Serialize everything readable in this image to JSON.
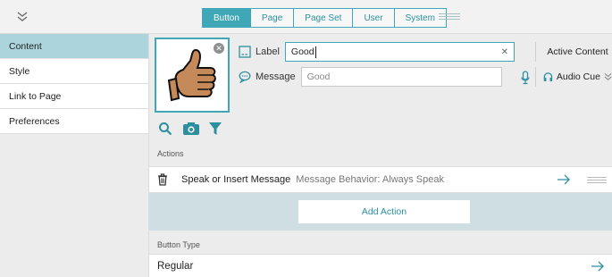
{
  "toolbar": {
    "tabs": [
      {
        "label": "Button",
        "active": true
      },
      {
        "label": "Page",
        "active": false
      },
      {
        "label": "Page Set",
        "active": false
      },
      {
        "label": "User",
        "active": false
      },
      {
        "label": "System",
        "active": false
      }
    ]
  },
  "sidebar": {
    "items": [
      {
        "label": "Content",
        "active": true
      },
      {
        "label": "Style",
        "active": false
      },
      {
        "label": "Link to Page",
        "active": false
      },
      {
        "label": "Preferences",
        "active": false
      }
    ]
  },
  "button_editor": {
    "label_field": {
      "label": "Label",
      "value": "Good"
    },
    "message_field": {
      "label": "Message",
      "placeholder": "Good",
      "value": ""
    },
    "active_content": "Active Content",
    "audio_cue": "Audio Cue",
    "close_glyph": "✕"
  },
  "actions": {
    "section_label": "Actions",
    "items": [
      {
        "name": "Speak or Insert Message",
        "description": "Message Behavior: Always Speak"
      }
    ],
    "add_label": "Add Action"
  },
  "button_type": {
    "section_label": "Button Type",
    "value": "Regular"
  },
  "colors": {
    "accent": "#3fa7b6",
    "sidebar_active": "#abd4dc",
    "add_action_bg": "#cfdee2"
  }
}
